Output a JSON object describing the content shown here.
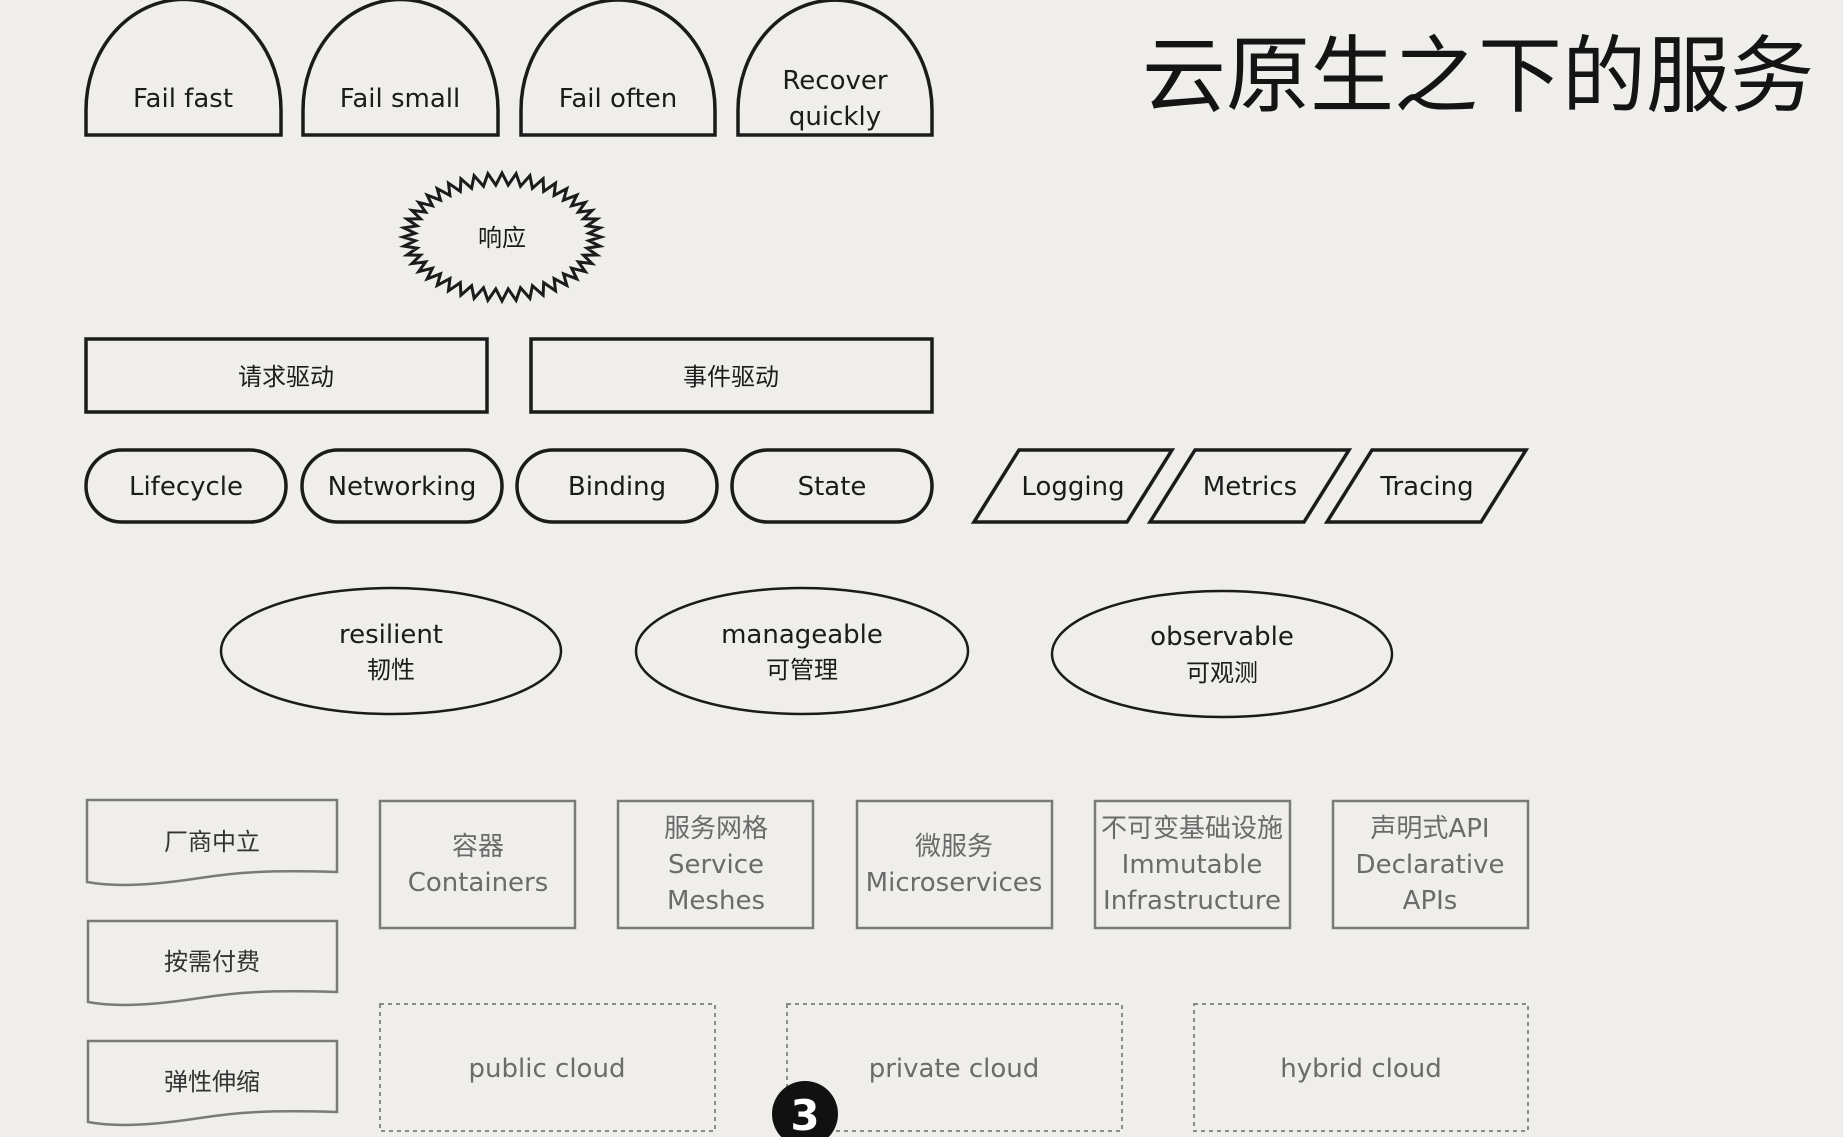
{
  "title": "云原生之下的服务",
  "domes": [
    "Fail fast",
    "Fail small",
    "Fail often",
    "Recover",
    "quickly"
  ],
  "burst": "响应",
  "drivers": [
    "请求驱动",
    "事件驱动"
  ],
  "pills": [
    "Lifecycle",
    "Networking",
    "Binding",
    "State"
  ],
  "parallelograms": [
    "Logging",
    "Metrics",
    "Tracing"
  ],
  "ellipses": [
    {
      "en": "resilient",
      "zh": "韧性"
    },
    {
      "en": "manageable",
      "zh": "可管理"
    },
    {
      "en": "observable",
      "zh": "可观测"
    }
  ],
  "waves": [
    "厂商中立",
    "按需付费",
    "弹性伸缩"
  ],
  "boxes": [
    {
      "l1": "容器",
      "l2": "Containers",
      "l3": ""
    },
    {
      "l1": "服务网格",
      "l2": "Service",
      "l3": "Meshes"
    },
    {
      "l1": "微服务",
      "l2": "Microservices",
      "l3": ""
    },
    {
      "l1": "不可变基础设施",
      "l2": "Immutable",
      "l3": "Infrastructure"
    },
    {
      "l1": "声明式API",
      "l2": "Declarative",
      "l3": "APIs"
    }
  ],
  "clouds": [
    "public cloud",
    "private cloud",
    "hybrid cloud"
  ],
  "page_marker": "3"
}
